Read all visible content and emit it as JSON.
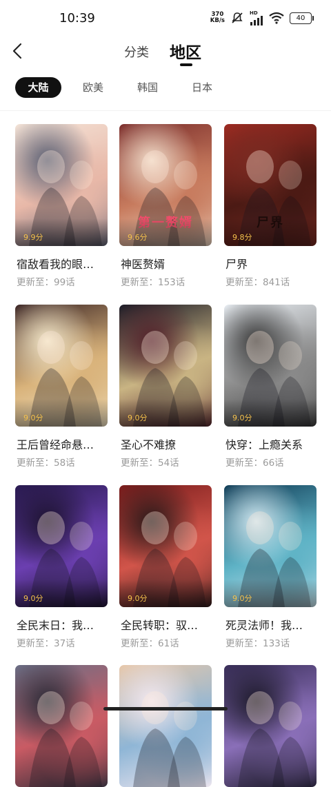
{
  "status_bar": {
    "time": "10:39",
    "net_speed_value": "370",
    "net_speed_unit": "KB/s",
    "hd_label": "HD",
    "battery": "40"
  },
  "header": {
    "tabs": [
      "分类",
      "地区"
    ],
    "active_tab": "地区"
  },
  "regions": {
    "items": [
      "大陆",
      "欧美",
      "韩国",
      "日本"
    ],
    "active": "大陆"
  },
  "comics": [
    {
      "title": "宿敌看我的眼…",
      "update": "更新至：99话",
      "score": "9.9分",
      "cover_text": "宿敌看我的…",
      "cover_colors": [
        "#f4e4d8",
        "#e8b8a8",
        "#5a5f73"
      ],
      "cover_text_color": "#e05a78",
      "show_cover_text": false
    },
    {
      "title": "神医赘婿",
      "update": "更新至：153话",
      "score": "9.6分",
      "cover_text": "第一赘婿",
      "cover_colors": [
        "#7a2c2a",
        "#c77b5e",
        "#f1dcc9"
      ],
      "cover_text_color": "#f04c6a",
      "show_cover_text": true
    },
    {
      "title": "尸界",
      "update": "更新至：841话",
      "score": "9.8分",
      "cover_text": "尸界",
      "cover_colors": [
        "#9e2b22",
        "#4b1a14",
        "#7a2b22"
      ],
      "cover_text_color": "#1e0c0a",
      "show_cover_text": true
    },
    {
      "title": "王后曾经命悬…",
      "update": "更新至：58话",
      "score": "9.0分",
      "cover_text": "",
      "cover_colors": [
        "#3a2424",
        "#d9b37b",
        "#f3e7c9"
      ],
      "cover_text_color": "#ffffff",
      "show_cover_text": false
    },
    {
      "title": "圣心不难撩",
      "update": "更新至：54话",
      "score": "9.0分",
      "cover_text": "圣心不难撩",
      "cover_colors": [
        "#1b1b26",
        "#c9b483",
        "#53202a"
      ],
      "cover_text_color": "#ffffff",
      "show_cover_text": false
    },
    {
      "title": "快穿：上瘾关系",
      "update": "更新至：66话",
      "score": "9.0分",
      "cover_text": "快穿·上瘾关系",
      "cover_colors": [
        "#e8edf2",
        "#8a8a8a",
        "#3a3a3a"
      ],
      "cover_text_color": "#222222",
      "show_cover_text": false
    },
    {
      "title": "全民末日：我…",
      "update": "更新至：37话",
      "score": "9.0分",
      "cover_text": "",
      "cover_colors": [
        "#2a1b52",
        "#6b3fb0",
        "#1d1330"
      ],
      "cover_text_color": "#ffffff",
      "show_cover_text": false
    },
    {
      "title": "全民转职：驭…",
      "update": "更新至：61话",
      "score": "9.0分",
      "cover_text": "",
      "cover_colors": [
        "#7a1c1c",
        "#d1554a",
        "#2a1a1a"
      ],
      "cover_text_color": "#ffffff",
      "show_cover_text": false
    },
    {
      "title": "死灵法师！我…",
      "update": "更新至：133话",
      "score": "9.0分",
      "cover_text": "",
      "cover_colors": [
        "#0f3b55",
        "#5fb3c6",
        "#cfe6ef"
      ],
      "cover_text_color": "#ffffff",
      "show_cover_text": false
    },
    {
      "title": "",
      "update": "",
      "score": "",
      "cover_text": "",
      "cover_colors": [
        "#6b6f86",
        "#c95b64",
        "#2a2a36"
      ],
      "cover_text_color": "#ffffff",
      "show_cover_text": false
    },
    {
      "title": "",
      "update": "",
      "score": "",
      "cover_text": "",
      "cover_colors": [
        "#e7c7a9",
        "#8fb6d6",
        "#f2e8f0"
      ],
      "cover_text_color": "#ffffff",
      "show_cover_text": false
    },
    {
      "title": "",
      "update": "",
      "score": "",
      "cover_text": "",
      "cover_colors": [
        "#3a2f5a",
        "#8a6fb8",
        "#1d1a2a"
      ],
      "cover_text_color": "#ffffff",
      "show_cover_text": false
    }
  ]
}
